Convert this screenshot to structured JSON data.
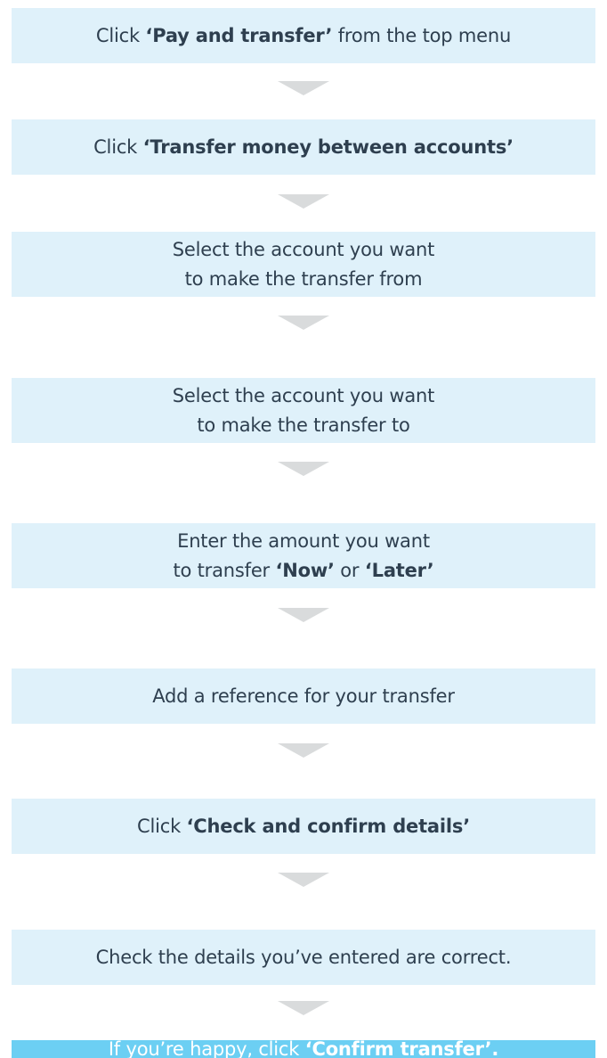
{
  "steps": [
    {
      "pre": "Click ",
      "bold": "‘Pay and transfer’",
      "post": " from the top menu"
    },
    {
      "pre": "Click ",
      "bold": "‘Transfer money between accounts’",
      "post": ""
    },
    {
      "line1": "Select the account you want",
      "line2": "to make the transfer from"
    },
    {
      "line1": "Select the account you want",
      "line2": "to make the transfer to"
    },
    {
      "line1": "Enter the amount you want",
      "line2_pre": "to transfer ",
      "line2_bold1": "‘Now’",
      "line2_mid": " or ",
      "line2_bold2": "‘Later’"
    },
    {
      "text": "Add a reference for your transfer"
    },
    {
      "pre": "Click ",
      "bold": "‘Check and confirm details’",
      "post": ""
    },
    {
      "text": "Check the details you’ve entered are correct."
    },
    {
      "pre": "If you’re happy, click ",
      "bold": "‘Confirm transfer’.",
      "post": ""
    }
  ],
  "colors": {
    "step_background": "#dff1fa",
    "final_step_background": "#6ccff3",
    "arrow": "#d9dbdc",
    "text": "#2e3f4f",
    "final_text": "#ffffff"
  }
}
